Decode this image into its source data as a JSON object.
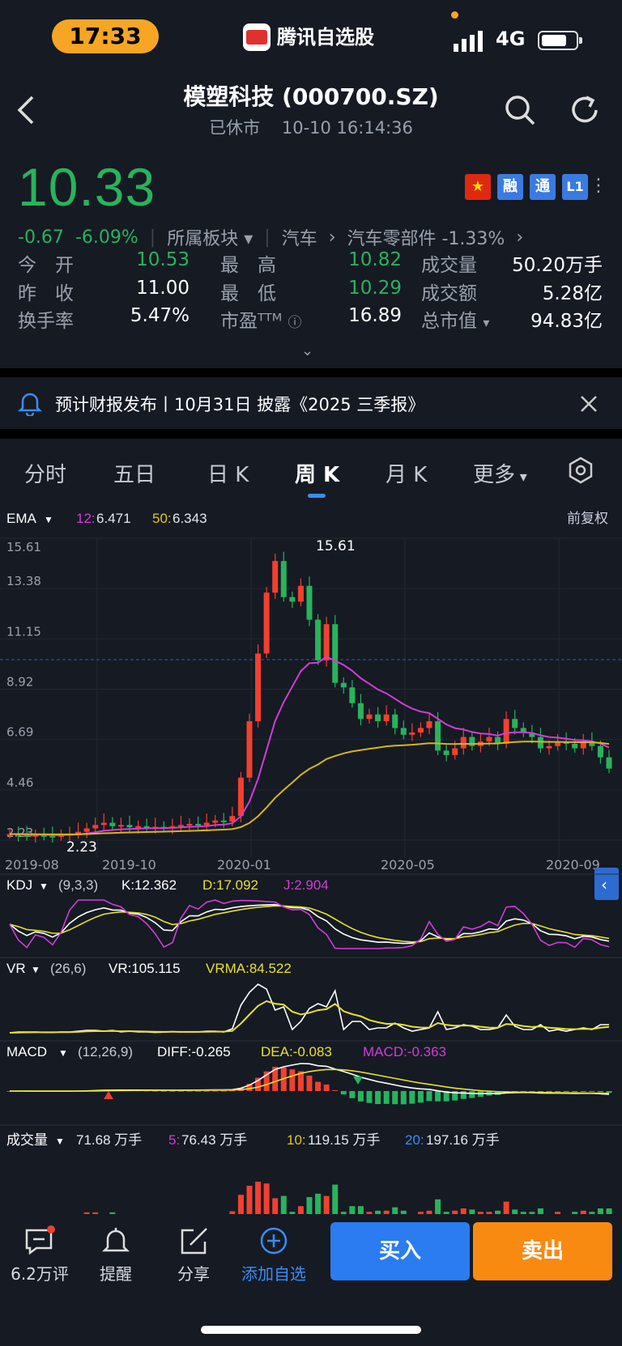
{
  "status": {
    "time": "17:33",
    "app_name": "腾讯自选股",
    "network": "4G"
  },
  "header": {
    "title": "模塑科技 (000700.SZ)",
    "market_state": "已休市",
    "datetime": "10-10 16:14:36"
  },
  "quote": {
    "price": "10.33",
    "change": "-0.67",
    "change_pct": "-6.09%",
    "sector_label": "所属板块",
    "sector_1": "汽车",
    "sector_2": "汽车零部件 -1.33%",
    "badges": {
      "rong": "融",
      "tong": "通",
      "level": "L1"
    },
    "stats": {
      "open_label": "今　开",
      "open": "10.53",
      "high_label": "最　高",
      "high": "10.82",
      "volume_label": "成交量",
      "volume": "50.20万手",
      "prev_label": "昨　收",
      "prev": "11.00",
      "low_label": "最　低",
      "low": "10.29",
      "amount_label": "成交额",
      "amount": "5.28亿",
      "turnover_label": "换手率",
      "turnover": "5.47%",
      "pe_label": "市盈ᵀᵀᴹ",
      "pe": "16.89",
      "mktcap_label": "总市值",
      "mktcap": "94.83亿"
    }
  },
  "notice": {
    "text": "预计财报发布丨10月31日 披露《2025 三季报》"
  },
  "tabs": [
    "分时",
    "五日",
    "日 K",
    "周 K",
    "月 K",
    "更多"
  ],
  "active_tab": "周 K",
  "chart": {
    "ema_label": "EMA",
    "ema12_label": "12:",
    "ema12": "6.471",
    "ema50_label": "50:",
    "ema50": "6.343",
    "adjust": "前复权",
    "high_mark": "15.61",
    "low_mark": "2.23",
    "y_ticks": [
      "15.61",
      "13.38",
      "11.15",
      "8.92",
      "6.69",
      "4.46",
      "2.23"
    ],
    "x_ticks": [
      "2019-08",
      "2019-10",
      "2020-01",
      "2020-05",
      "2020-09"
    ],
    "kdj": {
      "label": "KDJ",
      "params": "(9,3,3)",
      "k": "K:12.362",
      "d": "D:17.092",
      "j": "J:2.904"
    },
    "vr": {
      "label": "VR",
      "params": "(26,6)",
      "vr": "VR:105.115",
      "vrma": "VRMA:84.522"
    },
    "macd": {
      "label": "MACD",
      "params": "(12,26,9)",
      "diff": "DIFF:-0.265",
      "dea": "DEA:-0.083",
      "macd": "MACD:-0.363"
    },
    "vol": {
      "label": "成交量",
      "v": "71.68 万手",
      "ma5_label": "5:",
      "ma5": "76.43 万手",
      "ma10_label": "10:",
      "ma10": "119.15 万手",
      "ma20_label": "20:",
      "ma20": "197.16 万手"
    }
  },
  "chart_data": {
    "type": "candlestick",
    "x_ticks": [
      "2019-08",
      "2019-10",
      "2020-01",
      "2020-05",
      "2020-09"
    ],
    "ylim": [
      2.23,
      15.61
    ],
    "close": [
      2.5,
      2.45,
      2.4,
      2.45,
      2.42,
      2.4,
      2.45,
      2.5,
      2.6,
      2.75,
      2.9,
      3.0,
      2.85,
      2.9,
      2.8,
      2.85,
      2.8,
      2.82,
      2.78,
      2.85,
      2.9,
      2.95,
      2.9,
      3.0,
      3.1,
      3.05,
      3.3,
      5.0,
      7.5,
      10.5,
      13.2,
      14.6,
      13.0,
      12.8,
      13.5,
      12.0,
      10.2,
      11.8,
      9.2,
      9.0,
      8.3,
      7.6,
      7.8,
      7.5,
      7.8,
      7.2,
      6.9,
      7.0,
      7.2,
      7.5,
      6.2,
      6.0,
      6.3,
      6.8,
      6.4,
      6.6,
      6.8,
      6.5,
      7.6,
      7.2,
      7.0,
      6.8,
      6.3,
      6.4,
      6.6,
      6.5,
      6.3,
      6.6,
      6.4,
      5.9,
      5.4
    ],
    "ema12_last": 6.471,
    "ema50_last": 6.343,
    "kdj_last": {
      "K": 12.362,
      "D": 17.092,
      "J": 2.904
    },
    "vr_last": {
      "VR": 105.115,
      "VRMA": 84.522
    },
    "macd_last": {
      "DIFF": -0.265,
      "DEA": -0.083,
      "MACD": -0.363
    }
  },
  "bottom_nav": {
    "comments": "6.2万评",
    "alert": "提醒",
    "share": "分享",
    "add": "添加自选",
    "buy": "买入",
    "sell": "卖出"
  }
}
